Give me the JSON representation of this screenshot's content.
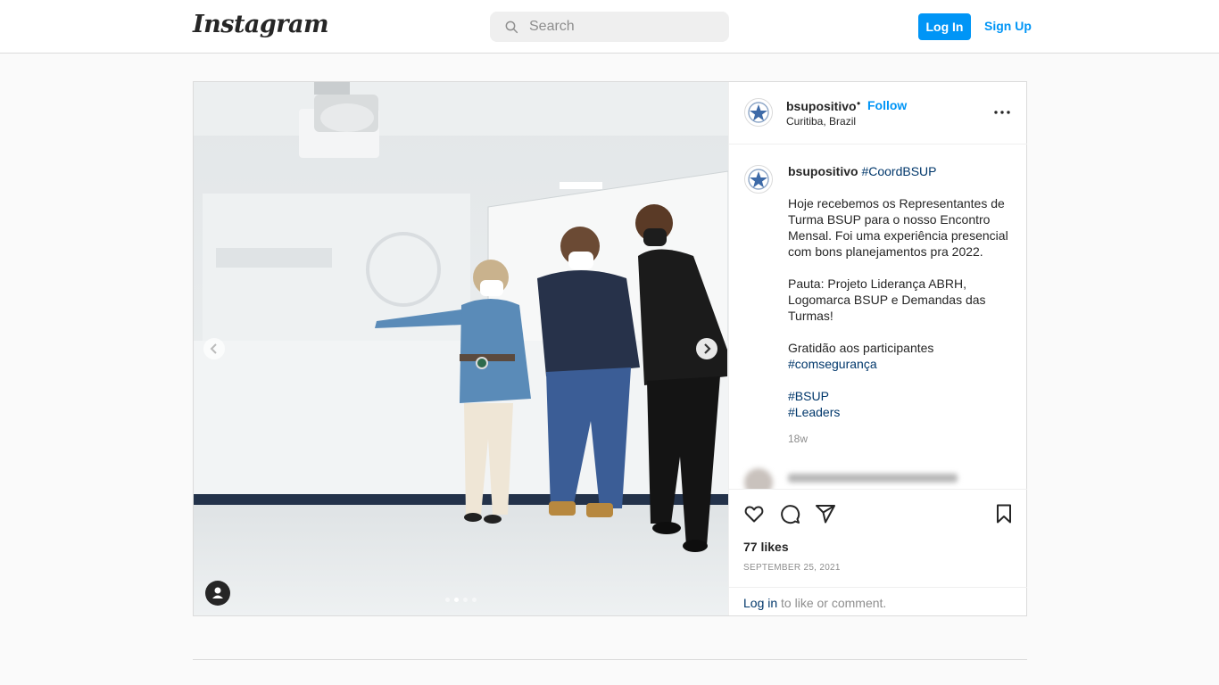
{
  "header": {
    "logo": "Instagram",
    "search_placeholder": "Search",
    "login": "Log In",
    "signup": "Sign Up"
  },
  "post": {
    "username": "bsupositivo",
    "follow": "Follow",
    "dot": "•",
    "location": "Curitiba, Brazil",
    "caption": {
      "tag_head": "#CoordBSUP",
      "p1": "Hoje recebemos os Representantes de Turma BSUP para o nosso Encontro Mensal. Foi uma experiência presencial com bons planejamentos pra 2022.",
      "p2": "Pauta: Projeto Liderança ABRH, Logomarca BSUP e Demandas das Turmas!",
      "p3": "Gratidão aos participantes",
      "tag_1": "#comsegurança",
      "tag_2": "#BSUP",
      "tag_3": "#Leaders",
      "age": "18w"
    },
    "likes": "77 likes",
    "date": "SEPTEMBER 25, 2021",
    "comment_login": "Log in",
    "comment_rest": " to like or comment.",
    "carousel_index": 2,
    "carousel_total": 4
  }
}
